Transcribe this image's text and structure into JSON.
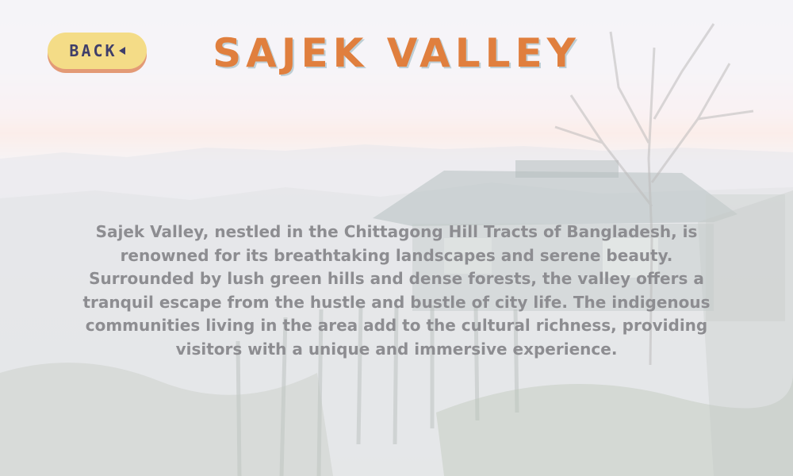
{
  "header": {
    "back_label": "BACK",
    "title": "SAJEK VALLEY"
  },
  "main": {
    "description": "Sajek Valley, nestled in the Chittagong Hill Tracts of Bangladesh, is renowned for its breathtaking landscapes and serene beauty. Surrounded by lush green hills and dense forests, the valley offers a tranquil escape from the hustle and bustle of city life. The indigenous communities living in the area add to the cultural richness, providing visitors with a unique and immersive experience."
  },
  "colors": {
    "title": "#e07f3e",
    "back_button_bg": "#f4dc87",
    "back_button_shadow": "#e39a76",
    "back_label": "#3f3e6a",
    "body_text": "#8d8d91"
  },
  "icons": {
    "back_arrow": "triangle-left-icon"
  }
}
